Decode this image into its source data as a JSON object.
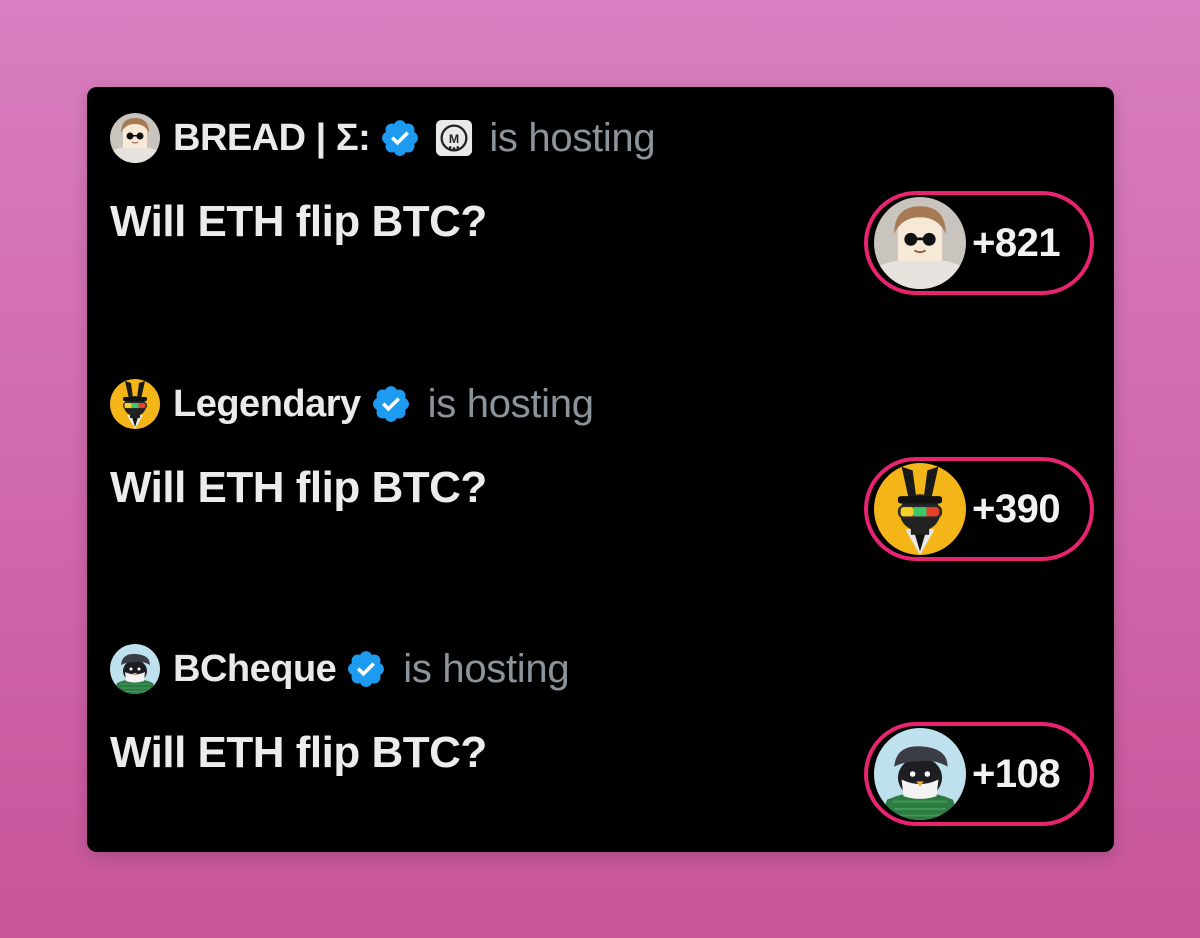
{
  "spaces": [
    {
      "host": "BREAD | Σ:",
      "status": "is hosting",
      "title": "Will ETH flip BTC?",
      "listeners": "+821",
      "avatar_icon": "bread-avatar-icon",
      "has_affiliate_badge": true
    },
    {
      "host": "Legendary",
      "status": "is hosting",
      "title": "Will ETH flip BTC?",
      "listeners": "+390",
      "avatar_icon": "bunny-avatar-icon",
      "has_affiliate_badge": false
    },
    {
      "host": "BCheque",
      "status": "is hosting",
      "title": "Will ETH flip BTC?",
      "listeners": "+108",
      "avatar_icon": "penguin-avatar-icon",
      "has_affiliate_badge": false
    }
  ],
  "colors": {
    "background_top": "#d97ec0",
    "background_bottom": "#c8559a",
    "card": "#000000",
    "verified_badge": "#1d9bf0",
    "highlight_ring": "#e8236f",
    "muted_text": "#8b939b"
  }
}
